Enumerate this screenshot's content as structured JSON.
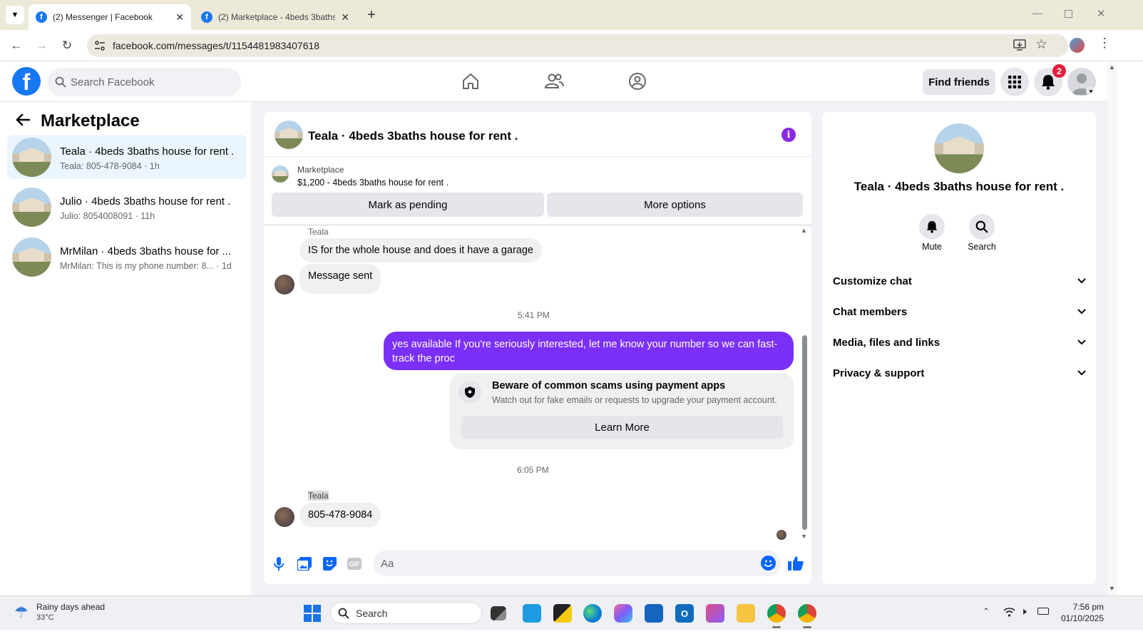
{
  "browser": {
    "tabs": [
      {
        "label": "(2) Messenger | Facebook",
        "active": true
      },
      {
        "label": "(2) Marketplace - 4beds 3baths",
        "active": false
      }
    ],
    "url": "facebook.com/messages/t/1154481983407618"
  },
  "fb_header": {
    "search_placeholder": "Search Facebook",
    "find_friends": "Find friends",
    "notification_count": "2"
  },
  "left": {
    "title": "Marketplace",
    "conversations": [
      {
        "name": "Teala · 4beds 3baths house for rent .",
        "preview": "Teala: 805-478-9084 · 1h",
        "selected": true
      },
      {
        "name": "Julio · 4beds 3baths house for rent .",
        "preview": "Julio: 8054008091 · 11h",
        "selected": false
      },
      {
        "name": "MrMilan · 4beds 3baths house for ...",
        "preview": "MrMilan: This is my phone number: 8... · 1d",
        "selected": false
      }
    ]
  },
  "chat": {
    "title": "Teala · 4beds 3baths house for rent .",
    "listing_source": "Marketplace",
    "listing_line": "$1,200 - 4beds 3baths house for rent .",
    "mark_pending": "Mark as pending",
    "more_options": "More options",
    "messages": {
      "sender1": "Teala",
      "msg1": "IS for the whole house and does it have a garage",
      "msg2": "Message sent",
      "time1": "5:41 PM",
      "outgoing": "yes available If you're seriously interested, let me know your number so we can fast-track the proc",
      "warn_title": "Beware of common scams using payment apps",
      "warn_body": "Watch out for fake emails or requests to upgrade your payment account.",
      "learn_more": "Learn More",
      "time2": "6:05 PM",
      "sender2": "Teala",
      "msg3": "805-478-9084"
    },
    "composer_placeholder": "Aa",
    "accent": "#7b2ff7"
  },
  "right": {
    "name": "Teala · 4beds 3baths house for rent .",
    "mute": "Mute",
    "search": "Search",
    "sections": [
      "Customize chat",
      "Chat members",
      "Media, files and links",
      "Privacy & support"
    ]
  },
  "taskbar": {
    "weather_title": "Rainy days ahead",
    "weather_temp": "33°C",
    "search": "Search",
    "time": "7:56 pm",
    "date": "01/10/2025"
  }
}
